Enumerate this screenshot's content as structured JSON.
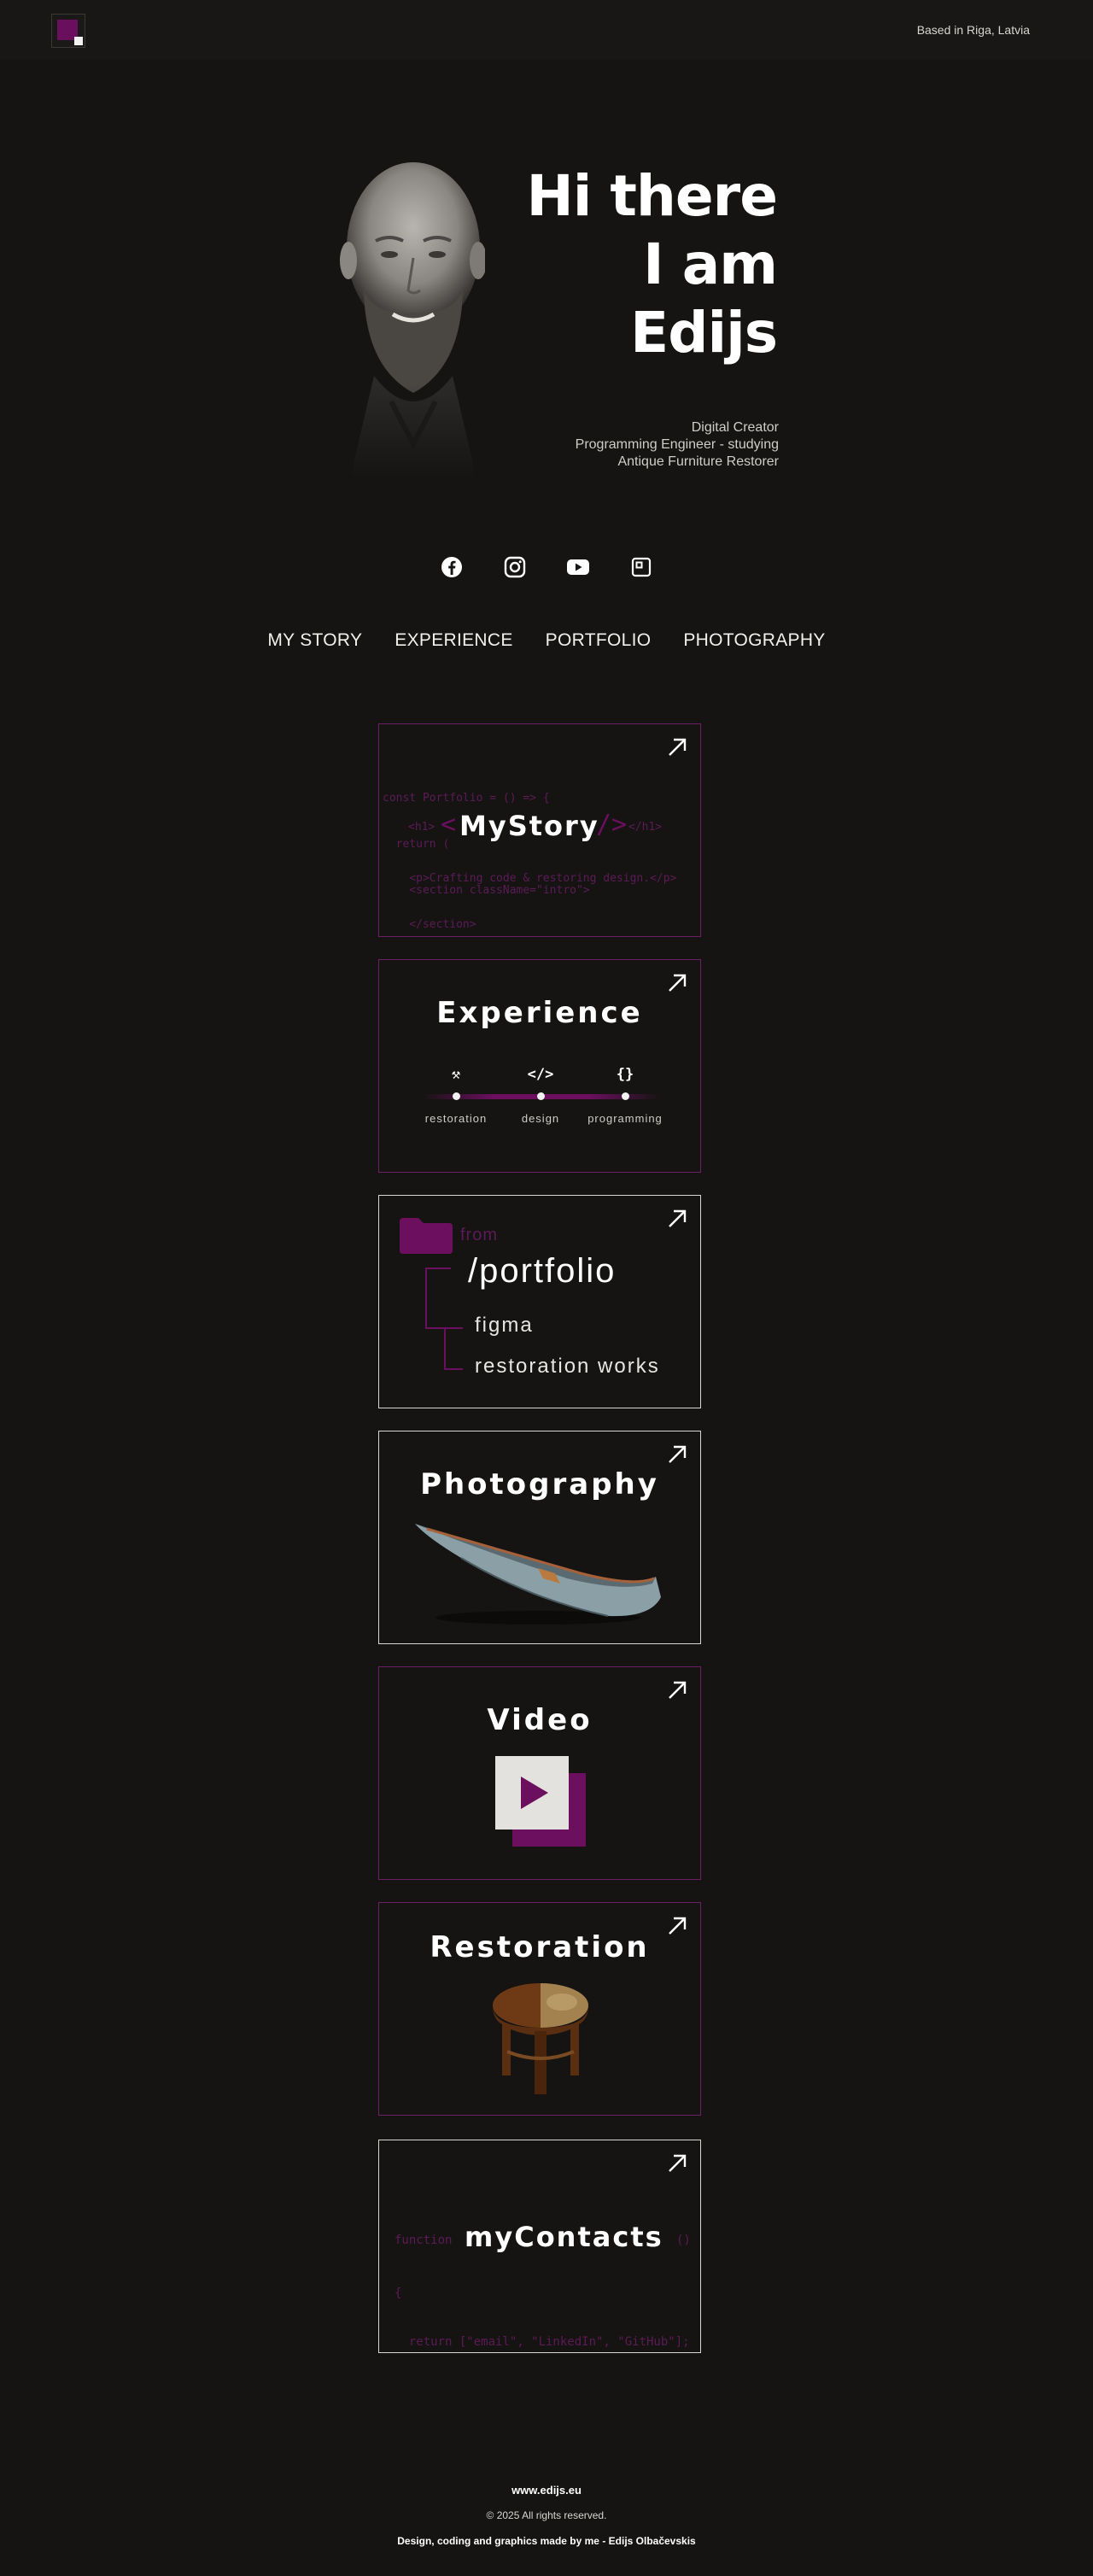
{
  "header": {
    "location": "Based in Riga, Latvia"
  },
  "hero": {
    "title_line1": "Hi there",
    "title_line2": "I am",
    "title_line3": "Edijs",
    "roles": [
      "Digital Creator",
      "Programming Engineer - studying",
      "Antique Furniture Restorer"
    ]
  },
  "socials": [
    "facebook-icon",
    "instagram-icon",
    "youtube-icon",
    "linkedin-square-icon"
  ],
  "nav": {
    "items": [
      "MY STORY",
      "EXPERIENCE",
      "PORTFOLIO",
      "PHOTOGRAPHY"
    ]
  },
  "cards": {
    "mystory": {
      "title_open": "<",
      "title": "MyStory",
      "title_close": "/>",
      "code_line1": "const Portfolio = () => {",
      "code_line2": "  return (",
      "code_line3": "    <section className=\"intro\">",
      "code_h1_open": "<h1>",
      "code_h1_close": "</h1>",
      "code_line5": "    <p>Crafting code & restoring design.</p>",
      "code_line6": "    </section>",
      "code_line7": "  );",
      "code_line8": "};"
    },
    "experience": {
      "title": "Experience",
      "icons": [
        "⚒",
        "</>",
        "{}"
      ],
      "labels": [
        "restoration",
        "design",
        "programming"
      ]
    },
    "portfolio": {
      "from": "from",
      "main": "/portfolio",
      "sub1": "figma",
      "sub2": "restoration works"
    },
    "photography": {
      "title": "Photography"
    },
    "video": {
      "title": "Video"
    },
    "restoration": {
      "title": "Restoration"
    },
    "contacts": {
      "keyword": "function",
      "title": "myContacts",
      "paren": "()",
      "line2": "{",
      "line3": "  return [\"email\", \"LinkedIn\", \"GitHub\"];",
      "line4": "}"
    }
  },
  "footer": {
    "site": "www.edijs.eu",
    "copyright": "© 2025 All rights reserved.",
    "credit": "Design, coding and graphics made by me - Edijs Olbačevskis"
  },
  "colors": {
    "background": "#151412",
    "accent": "#6b0f5e",
    "text": "#ffffff"
  }
}
